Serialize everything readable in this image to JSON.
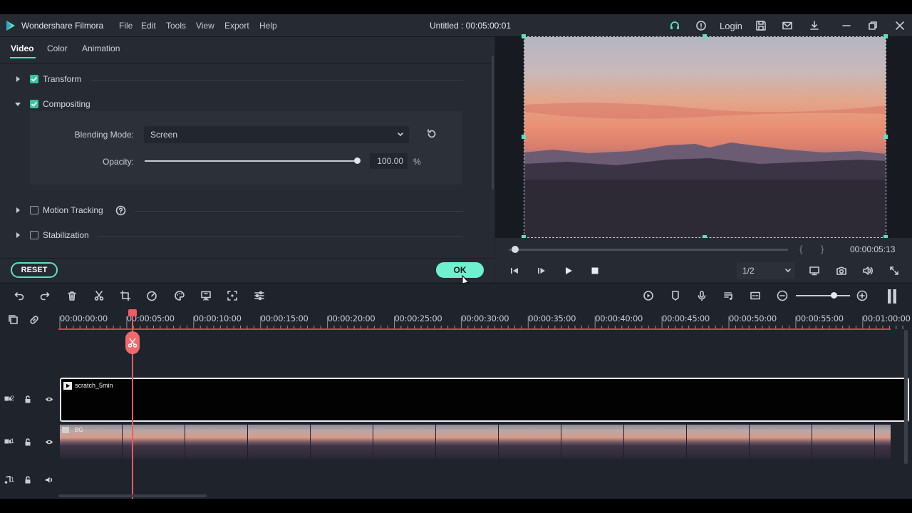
{
  "app": {
    "name": "Wondershare Filmora",
    "project_title": "Untitled : 00:05:00:01",
    "menu": [
      "File",
      "Edit",
      "Tools",
      "View",
      "Export",
      "Help"
    ],
    "login_label": "Login"
  },
  "left_panel": {
    "tabs": [
      "Video",
      "Color",
      "Animation"
    ],
    "active_tab": "Video",
    "sections": {
      "transform": {
        "label": "Transform",
        "checked": true
      },
      "compositing": {
        "label": "Compositing",
        "checked": true
      },
      "motion_tracking": {
        "label": "Motion Tracking",
        "checked": false
      },
      "stabilization": {
        "label": "Stabilization",
        "checked": false
      }
    },
    "blending_mode_label": "Blending Mode:",
    "blending_mode_value": "Screen",
    "opacity_label": "Opacity:",
    "opacity_value": "100.00",
    "opacity_unit": "%",
    "opacity_level": 1.0,
    "reset_label": "RESET",
    "ok_label": "OK"
  },
  "preview": {
    "timecode": "00:00:05:13",
    "scrub_fraction": 0.02,
    "quality": "1/2",
    "bracket_in": "{",
    "bracket_out": "}"
  },
  "timeline": {
    "ruler_ticks": [
      "00:00:00:00",
      "00:00:05:00",
      "00:00:10:00",
      "00:00:15:00",
      "00:00:20:00",
      "00:00:25:00",
      "00:00:30:00",
      "00:00:35:00",
      "00:00:40:00",
      "00:00:45:00",
      "00:00:50:00",
      "00:00:55:00",
      "00:01:00:00"
    ],
    "zoom_level": 0.7,
    "tracks": {
      "v2": {
        "label": "2",
        "clip_name": "scratch_5min"
      },
      "v1": {
        "label": "1",
        "clip_name": "BG"
      },
      "a1": {
        "label": "1"
      }
    }
  },
  "colors": {
    "accent": "#5ee0c3",
    "playhead": "#f05a60",
    "panel": "#262a32"
  }
}
